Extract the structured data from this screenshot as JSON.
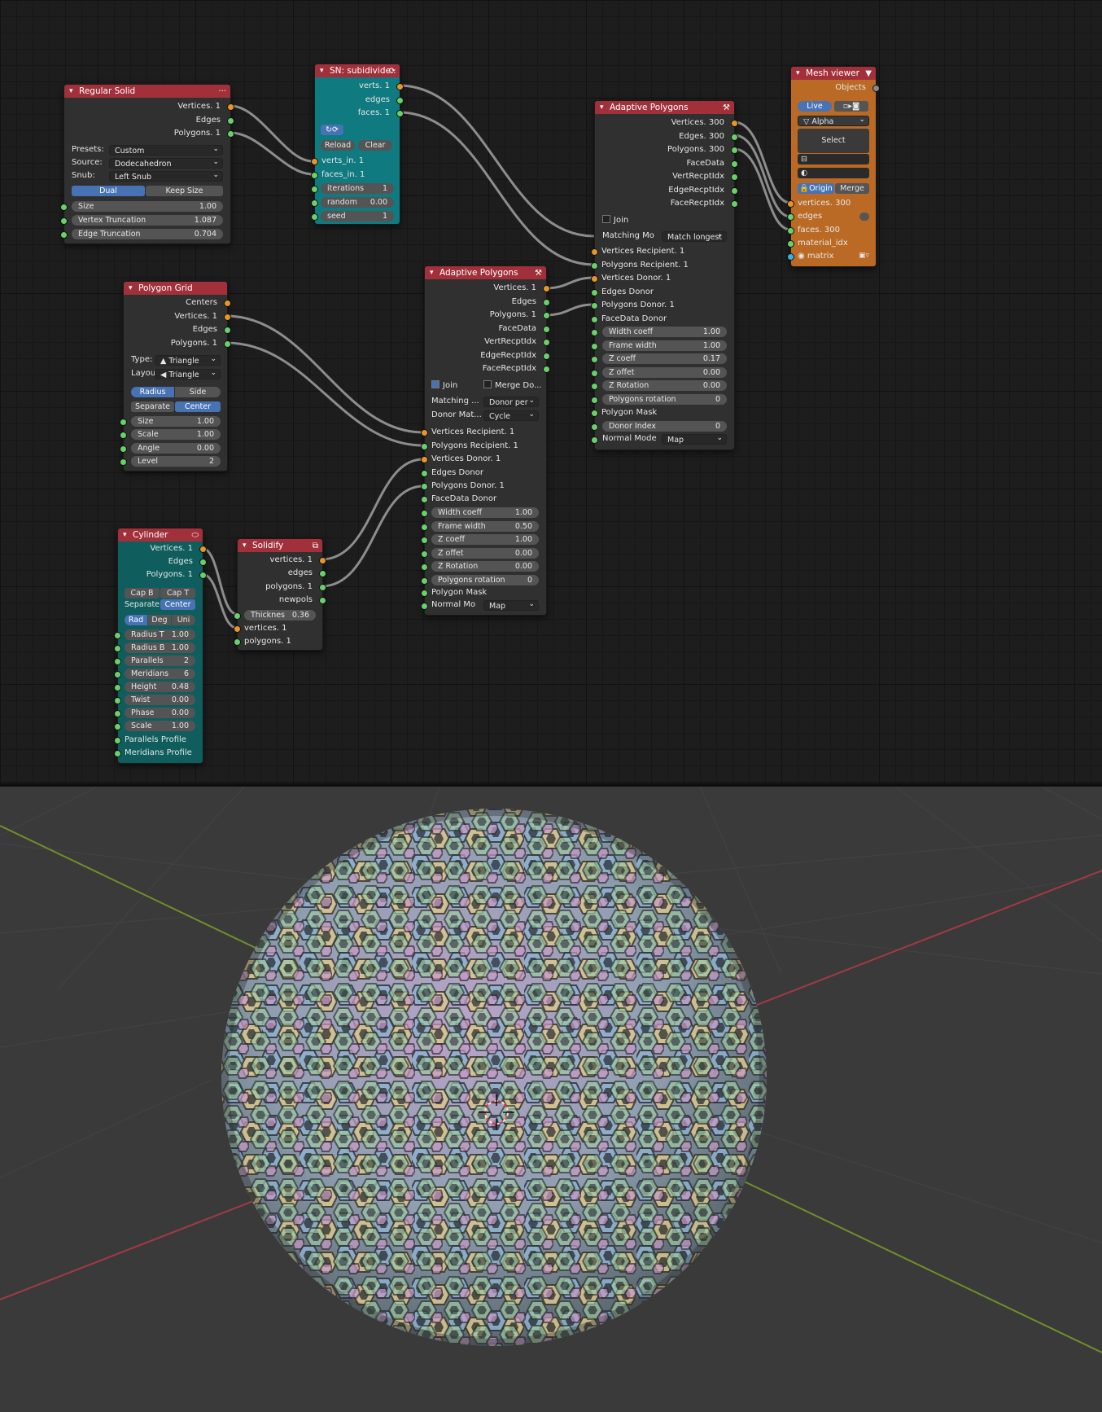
{
  "nodes": {
    "regular_solid": {
      "title": "Regular Solid",
      "outputs": [
        "Vertices. 1",
        "Edges",
        "Polygons. 1"
      ],
      "presets_label": "Presets:",
      "presets_value": "Custom",
      "source_label": "Source:",
      "source_value": "Dodecahedron",
      "snub_label": "Snub:",
      "snub_value": "Left Snub",
      "toggle_dual": "Dual",
      "toggle_keep_size": "Keep Size",
      "fields": [
        {
          "label": "Size",
          "value": "1.00"
        },
        {
          "label": "Vertex Truncation",
          "value": "1.087"
        },
        {
          "label": "Edge Truncation",
          "value": "0.704"
        }
      ]
    },
    "sn_subdivide": {
      "title": "SN: subidivide..",
      "outputs": [
        "verts. 1",
        "edges",
        "faces. 1"
      ],
      "reload": "Reload",
      "clear": "Clear",
      "inputs": [
        "verts_in. 1",
        "faces_in. 1"
      ],
      "fields": [
        {
          "label": "iterations",
          "value": "1"
        },
        {
          "label": "random",
          "value": "0.00"
        },
        {
          "label": "seed",
          "value": "1"
        }
      ]
    },
    "polygon_grid": {
      "title": "Polygon Grid",
      "outputs": [
        "Centers",
        "Vertices. 1",
        "Edges",
        "Polygons. 1"
      ],
      "type_label": "Type:",
      "type_value": "Triangle",
      "layout_label": "Layou",
      "layout_value": "Triangle",
      "radius": "Radius",
      "side": "Side",
      "separate": "Separate",
      "center": "Center",
      "fields": [
        {
          "label": "Size",
          "value": "1.00"
        },
        {
          "label": "Scale",
          "value": "1.00"
        },
        {
          "label": "Angle",
          "value": "0.00"
        },
        {
          "label": "Level",
          "value": "2"
        }
      ]
    },
    "cylinder": {
      "title": "Cylinder",
      "outputs": [
        "Vertices. 1",
        "Edges",
        "Polygons. 1"
      ],
      "cap_b": "Cap B",
      "cap_t": "Cap T",
      "separate": "Separate",
      "center": "Center",
      "rad": "Rad",
      "deg": "Deg",
      "uni": "Uni",
      "fields": [
        {
          "label": "Radius T",
          "value": "1.00"
        },
        {
          "label": "Radius B",
          "value": "1.00"
        },
        {
          "label": "Parallels",
          "value": "2"
        },
        {
          "label": "Meridians",
          "value": "6"
        },
        {
          "label": "Height",
          "value": "0.48"
        },
        {
          "label": "Twist",
          "value": "0.00"
        },
        {
          "label": "Phase",
          "value": "0.00"
        },
        {
          "label": "Scale",
          "value": "1.00"
        }
      ],
      "inputs": [
        "Parallels Profile",
        "Meridians Profile"
      ]
    },
    "solidify": {
      "title": "Solidify",
      "outputs": [
        "vertices. 1",
        "edges",
        "polygons. 1",
        "newpols"
      ],
      "field": {
        "label": "Thicknes",
        "value": "0.36"
      },
      "inputs": [
        "vertices. 1",
        "polygons. 1"
      ]
    },
    "adaptive_small": {
      "title": "Adaptive Polygons",
      "outputs": [
        "Vertices. 1",
        "Edges",
        "Polygons. 1",
        "FaceData",
        "VertRecptIdx",
        "EdgeRecptIdx",
        "FaceRecptIdx"
      ],
      "join": "Join",
      "merge": "Merge Do...",
      "matching_label": "Matching ...",
      "matching_value": "Donor per",
      "donor_label": "Donor Mat...",
      "donor_value": "Cycle",
      "inputs": [
        "Vertices Recipient. 1",
        "Polygons Recipient. 1",
        "Vertices Donor. 1",
        "Edges Donor",
        "Polygons Donor. 1",
        "FaceData Donor"
      ],
      "fields": [
        {
          "label": "Width coeff",
          "value": "1.00"
        },
        {
          "label": "Frame width",
          "value": "0.50"
        },
        {
          "label": "Z coeff",
          "value": "1.00"
        },
        {
          "label": "Z offet",
          "value": "0.00"
        },
        {
          "label": "Z Rotation",
          "value": "0.00"
        },
        {
          "label": "Polygons rotation",
          "value": "0"
        }
      ],
      "polygon_mask": "Polygon Mask",
      "normal_label": "Normal Mo",
      "normal_value": "Map"
    },
    "adaptive_big": {
      "title": "Adaptive Polygons",
      "outputs": [
        "Vertices. 300",
        "Edges. 300",
        "Polygons. 300",
        "FaceData",
        "VertRecptIdx",
        "EdgeRecptIdx",
        "FaceRecptIdx"
      ],
      "join": "Join",
      "matching_label": "Matching Mo",
      "matching_value": "Match longest",
      "inputs": [
        "Vertices Recipient. 1",
        "Polygons Recipient. 1",
        "Vertices Donor. 1",
        "Edges Donor",
        "Polygons Donor. 1",
        "FaceData Donor"
      ],
      "fields": [
        {
          "label": "Width coeff",
          "value": "1.00"
        },
        {
          "label": "Frame width",
          "value": "1.00"
        },
        {
          "label": "Z coeff",
          "value": "0.17"
        },
        {
          "label": "Z offet",
          "value": "0.00"
        },
        {
          "label": "Z Rotation",
          "value": "0.00"
        },
        {
          "label": "Polygons rotation",
          "value": "0"
        }
      ],
      "polygon_mask": "Polygon Mask",
      "donor_index": {
        "label": "Donor Index",
        "value": "0"
      },
      "normal_label": "Normal Mode",
      "normal_value": "Map"
    },
    "mesh_viewer": {
      "title": "Mesh viewer",
      "output": "Objects",
      "live": "Live",
      "alpha": "Alpha",
      "select": "Select",
      "origin": "Origin",
      "merge": "Merge",
      "inputs": [
        "vertices. 300",
        "edges",
        "faces. 300",
        "material_idx",
        "matrix"
      ]
    }
  },
  "colors": {
    "header_red": "#a2303a",
    "teal_node": "#0f7a7f",
    "cylinder_node": "#0f5d5d",
    "viewer_node": "#ba6a24",
    "socket_green": "#6ad06a",
    "socket_orange": "#e8962a",
    "accent_blue": "#4772b3"
  }
}
